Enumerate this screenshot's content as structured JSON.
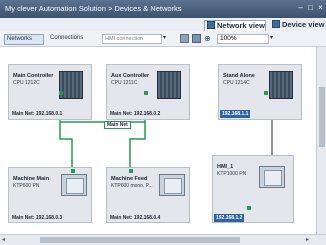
{
  "window": {
    "title": "My clever Automation Solution > Devices & Networks"
  },
  "view_tabs": {
    "network": "Network view",
    "device": "Device view"
  },
  "toolbar": {
    "networks_label": "Networks",
    "connections_label": "Connections",
    "connection_type": "HMI connection",
    "zoom": "100%"
  },
  "devices": [
    {
      "name": "Main Controller",
      "type": "CPU 1212C",
      "network": "Main Net: 192.168.0.1"
    },
    {
      "name": "Aux Controller",
      "type": "CPU 1211C",
      "network": "Main Net: 192.168.0.2"
    },
    {
      "name": "Stand Alone",
      "type": "CPU 1214C",
      "network": "192.168.1.1"
    },
    {
      "name": "Machine Main",
      "type": "KTP600 PN",
      "network": "Main Net: 192.168.0.3"
    },
    {
      "name": "Machine Feed",
      "type": "KTP600 mono. P...",
      "network": "Main Net: 192.168.0.4"
    },
    {
      "name": "HMI_1",
      "type": "KTP1000 PN",
      "network": "192.168.1.2"
    }
  ],
  "subnet": {
    "label": "Main Net"
  },
  "colors": {
    "profinet_wire": "#1f9e53",
    "highlight": "#2e63a6"
  }
}
